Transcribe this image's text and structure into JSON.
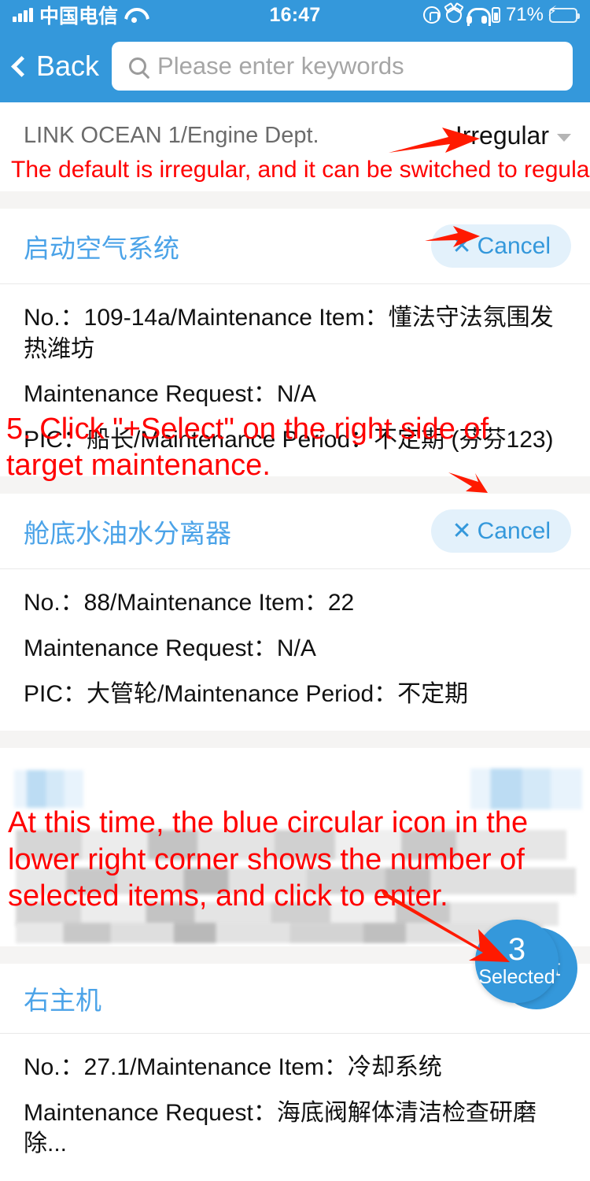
{
  "status_bar": {
    "carrier": "中国电信",
    "time": "16:47",
    "battery_percent": "71%",
    "icons": [
      "signal-bars-icon",
      "wifi-icon",
      "rotation-lock-icon",
      "alarm-clock-icon",
      "headphones-icon",
      "vertical-battery-icon",
      "battery-charging-icon"
    ]
  },
  "nav": {
    "back_label": "Back",
    "search_placeholder": "Please enter keywords",
    "search_value": ""
  },
  "header_row": {
    "vessel": "LINK OCEAN 1/Engine Dept.",
    "period_selector": "Irregular"
  },
  "annotations": {
    "note_top": "The default is irregular, and it can be switched to regular.",
    "step_5": "5. Click \"+Select\" on the right side of target maintenance.",
    "step_note": "At this time, the blue circular icon in the lower right corner shows the number of selected items, and click to enter."
  },
  "sections": [
    {
      "title": "启动空气系统",
      "action_label": "Cancel",
      "action_icon": "✕",
      "rows": [
        "No.：109-14a/Maintenance Item：懂法守法氛围发热潍坊",
        "Maintenance Request：N/A",
        "PIC：船长/Maintenance Period：不定期 (芬芬123)"
      ]
    },
    {
      "title": "舱底水油水分离器",
      "action_label": "Cancel",
      "action_icon": "✕",
      "rows": [
        "No.：88/Maintenance Item：22",
        "Maintenance Request：N/A",
        "PIC：大管轮/Maintenance Period：不定期"
      ]
    },
    {
      "title": "右主机",
      "action_label": "",
      "action_icon": "",
      "rows": [
        "No.：27.1/Maintenance Item：冷却系统",
        "Maintenance Request：海底阀解体清洁检查研磨除..."
      ]
    }
  ],
  "floating_badge": {
    "count": "3",
    "label": "Selected",
    "behind_label": "t"
  },
  "colors": {
    "brand_blue": "#3498db",
    "link_blue": "#4ba3e8",
    "annotation_red": "#ff0000",
    "chip_bg": "#e3f1fb",
    "divider": "#f5f4f3"
  }
}
